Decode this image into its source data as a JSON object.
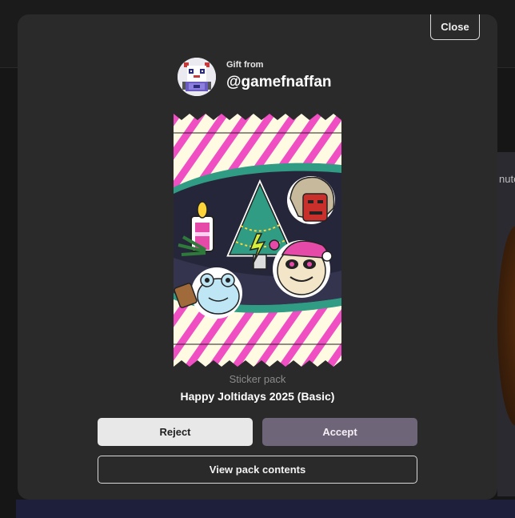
{
  "background": {
    "right_snippet": "nute"
  },
  "modal": {
    "close_label": "Close",
    "gift": {
      "label": "Gift from",
      "username": "@gamefnaffan"
    },
    "pack": {
      "type_label": "Sticker pack",
      "name": "Happy Joltidays 2025 (Basic)"
    },
    "actions": {
      "reject_label": "Reject",
      "accept_label": "Accept",
      "view_contents_label": "View pack contents"
    }
  },
  "colors": {
    "modal_bg": "#2a2a2a",
    "accept_bg": "#6f6578",
    "reject_bg": "#e8e8e8",
    "stripe_pink": "#f04fc3",
    "wrapper_cream": "#fff9dc"
  },
  "icons": {
    "avatar": "pixel-art-avatar",
    "pack_art": "sticker-pack-art"
  }
}
